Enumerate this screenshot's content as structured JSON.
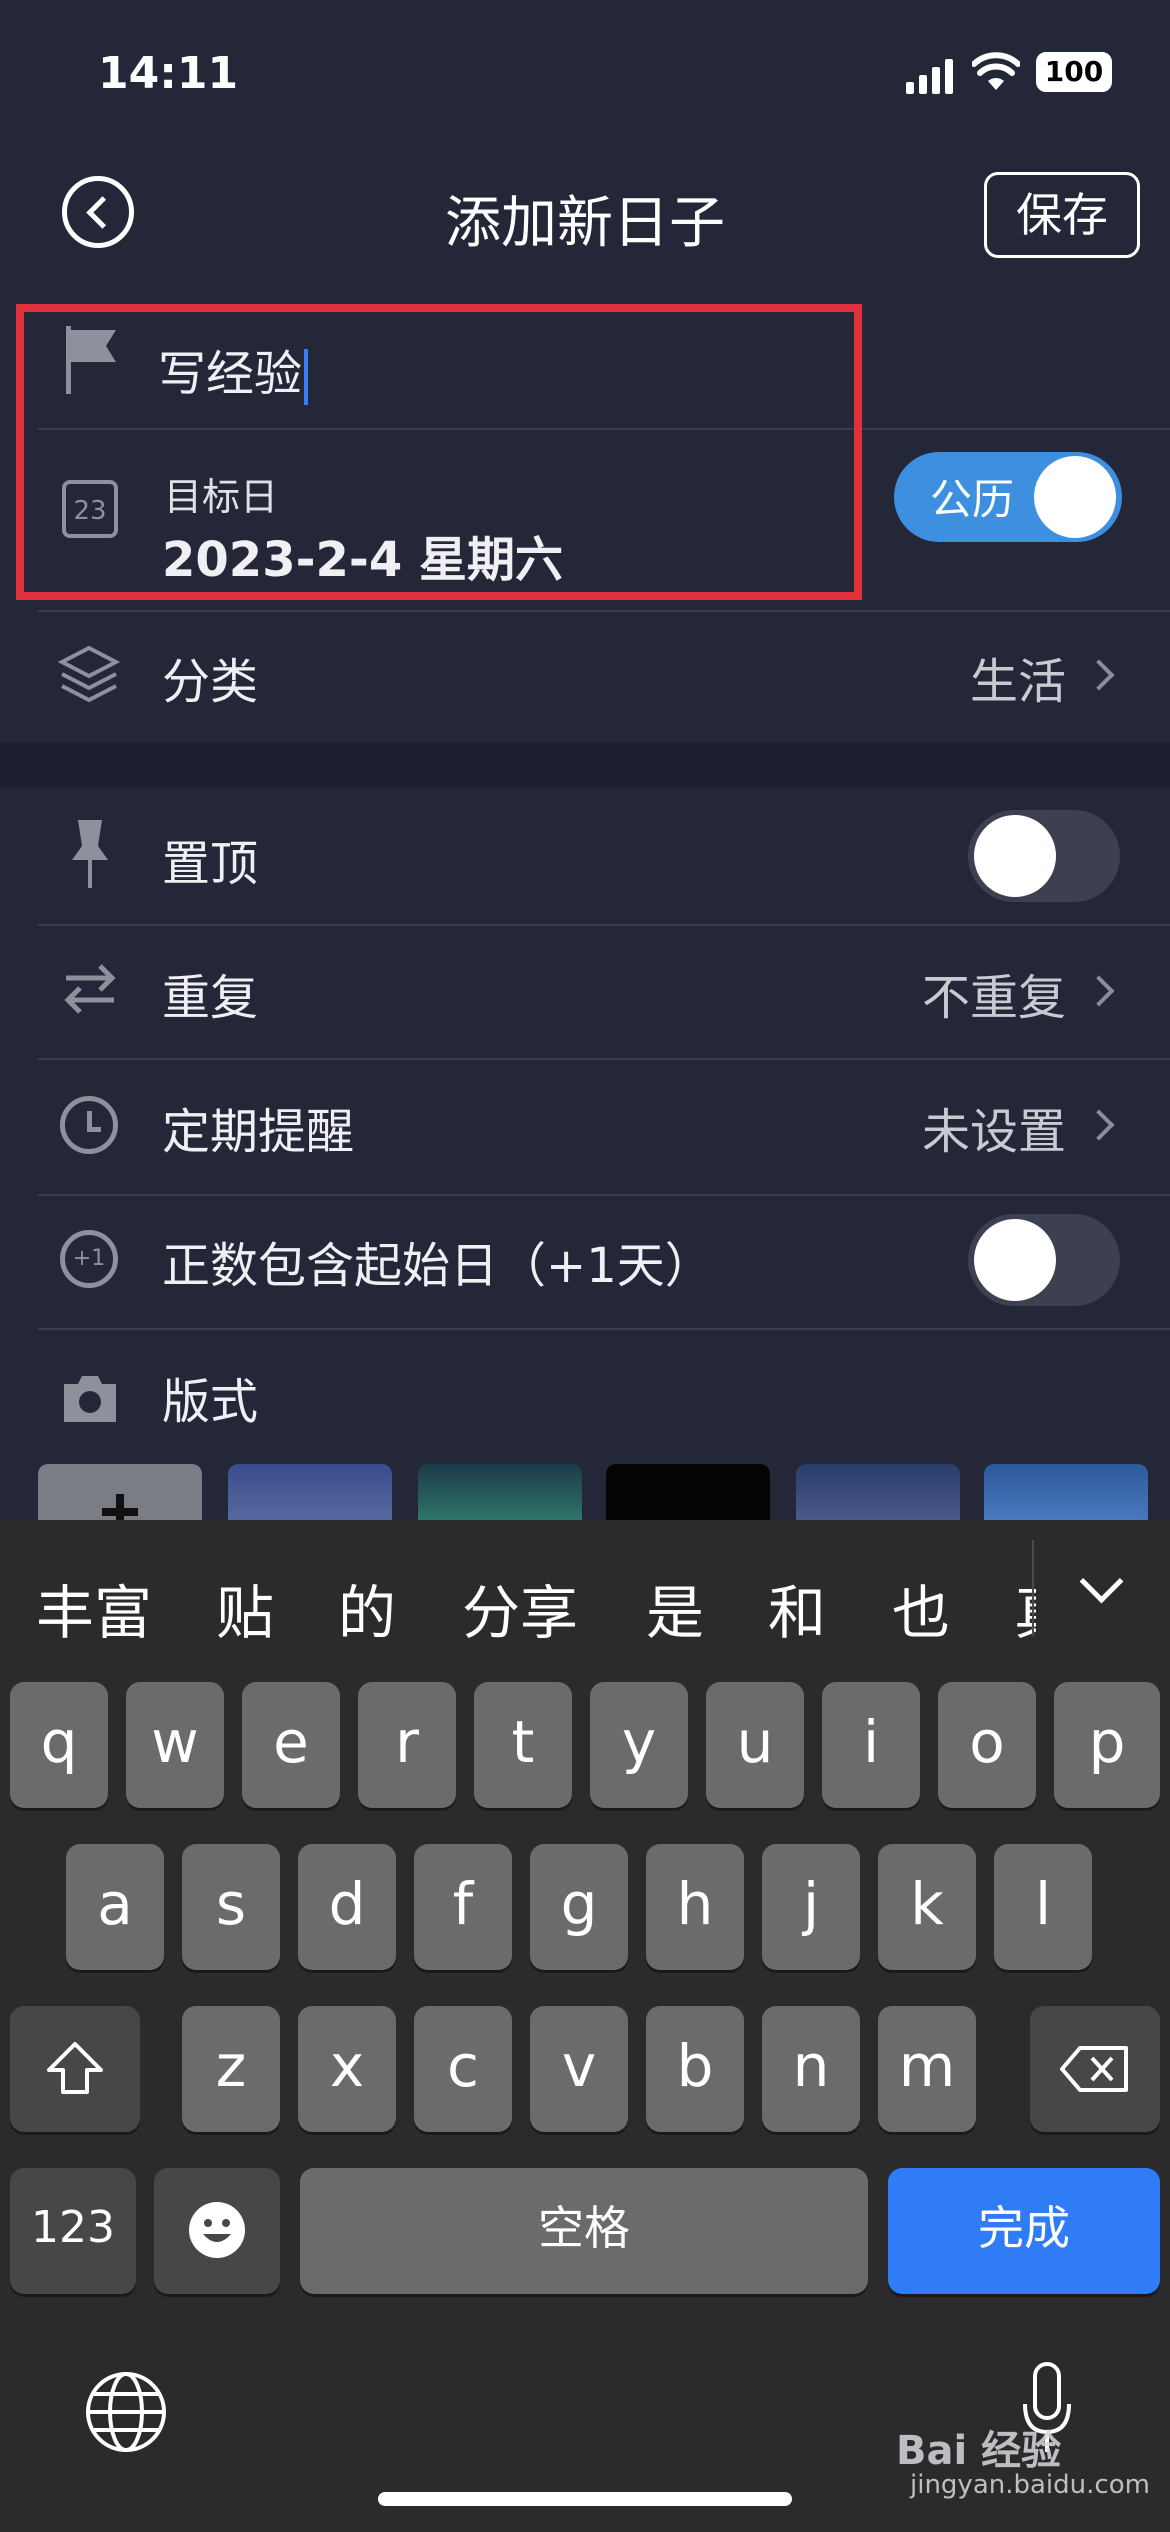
{
  "status_bar": {
    "time": "14:11",
    "battery": "100"
  },
  "nav": {
    "title": "添加新日子",
    "save_label": "保存"
  },
  "event": {
    "title_value": "写经验"
  },
  "target_date": {
    "label": "目标日",
    "value": "2023-2-4 星期六",
    "calendar_icon_text": "23",
    "calendar_toggle_label": "公历"
  },
  "category": {
    "label": "分类",
    "value": "生活"
  },
  "pin": {
    "label": "置顶",
    "enabled": false
  },
  "repeat": {
    "label": "重复",
    "value": "不重复"
  },
  "reminder": {
    "label": "定期提醒",
    "value": "未设置"
  },
  "include_start": {
    "label": "正数包含起始日（+1天）",
    "icon_text": "+1",
    "enabled": false
  },
  "style": {
    "label": "版式"
  },
  "keyboard": {
    "candidates": [
      "丰富",
      "贴",
      "的",
      "分享",
      "是",
      "和",
      "也",
      "真"
    ],
    "row1": [
      "q",
      "w",
      "e",
      "r",
      "t",
      "y",
      "u",
      "i",
      "o",
      "p"
    ],
    "row2": [
      "a",
      "s",
      "d",
      "f",
      "g",
      "h",
      "j",
      "k",
      "l"
    ],
    "row3": [
      "z",
      "x",
      "c",
      "v",
      "b",
      "n",
      "m"
    ],
    "numbers_label": "123",
    "space_label": "空格",
    "done_label": "完成"
  },
  "watermark": {
    "text": "Bai 经验",
    "url": "jingyan.baidu.com"
  },
  "colors": {
    "background": "#232738",
    "accent": "#3e8fe0",
    "highlight": "#e0303c",
    "keyboard": "#2b2b2d",
    "done_key": "#2f7cf6"
  }
}
